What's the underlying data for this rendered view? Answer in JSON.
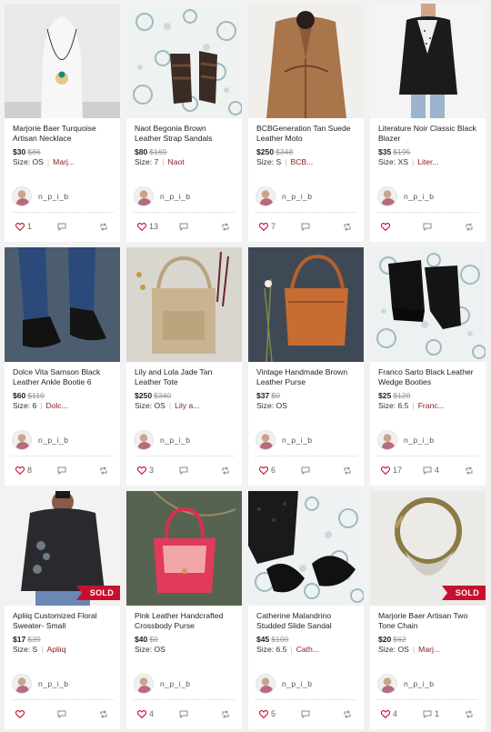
{
  "listings": [
    {
      "title": "Marjorie Baer Turquoise Artisan Necklace",
      "price": "$30",
      "original_price": "$86",
      "size_label": "Size: OS",
      "brand": "Marj...",
      "seller": "n_p_i_b",
      "likes": "1",
      "comments": "",
      "shares": "",
      "sold": false,
      "sold_label": "",
      "image": "necklace"
    },
    {
      "title": "Naot Begonia Brown Leather Strap Sandals",
      "price": "$80",
      "original_price": "$169",
      "size_label": "Size: 7",
      "brand": "Naot",
      "seller": "n_p_i_b",
      "likes": "13",
      "comments": "",
      "shares": "",
      "sold": false,
      "sold_label": "",
      "image": "sandals"
    },
    {
      "title": "BCBGeneration Tan Suede Leather Moto",
      "price": "$250",
      "original_price": "$348",
      "size_label": "Size: S",
      "brand": "BCB...",
      "seller": "n_p_i_b",
      "likes": "7",
      "comments": "",
      "shares": "",
      "sold": false,
      "sold_label": "",
      "image": "jacket"
    },
    {
      "title": "Literature Noir Classic Black Blazer",
      "price": "$35",
      "original_price": "$195",
      "size_label": "Size: XS",
      "brand": "Liter...",
      "seller": "n_p_i_b",
      "likes": "",
      "comments": "",
      "shares": "",
      "sold": false,
      "sold_label": "",
      "image": "blazer"
    },
    {
      "title": "Dolce Vita Samson Black Leather Ankle Bootie 6",
      "price": "$60",
      "original_price": "$110",
      "size_label": "Size: 6",
      "brand": "Dolc...",
      "seller": "n_p_i_b",
      "likes": "8",
      "comments": "",
      "shares": "",
      "sold": false,
      "sold_label": "",
      "image": "booties"
    },
    {
      "title": "Lily and Lola Jade Tan Leather Tote",
      "price": "$250",
      "original_price": "$340",
      "size_label": "Size: OS",
      "brand": "Lily a...",
      "seller": "n_p_i_b",
      "likes": "3",
      "comments": "",
      "shares": "",
      "sold": false,
      "sold_label": "",
      "image": "tote"
    },
    {
      "title": "Vintage Handmade Brown Leather Purse",
      "price": "$37",
      "original_price": "$0",
      "size_label": "Size: OS",
      "brand": "",
      "seller": "n_p_i_b",
      "likes": "6",
      "comments": "",
      "shares": "",
      "sold": false,
      "sold_label": "",
      "image": "purse"
    },
    {
      "title": "Franco Sarto Black Leather Wedge Booties",
      "price": "$25",
      "original_price": "$120",
      "size_label": "Size: 6.5",
      "brand": "Franc...",
      "seller": "n_p_i_b",
      "likes": "17",
      "comments": "4",
      "shares": "",
      "sold": false,
      "sold_label": "",
      "image": "wedge"
    },
    {
      "title": "Apliiq Customized Floral Sweater- Small",
      "price": "$17",
      "original_price": "$39",
      "size_label": "Size: S",
      "brand": "Apliiq",
      "seller": "n_p_i_b",
      "likes": "",
      "comments": "",
      "shares": "",
      "sold": true,
      "sold_label": "SOLD",
      "image": "sweater"
    },
    {
      "title": "Pink Leather Handcrafted Crossbody Purse",
      "price": "$40",
      "original_price": "$0",
      "size_label": "Size: OS",
      "brand": "",
      "seller": "n_p_i_b",
      "likes": "4",
      "comments": "",
      "shares": "",
      "sold": false,
      "sold_label": "",
      "image": "crossbody"
    },
    {
      "title": "Catherine Malandrino Studded Slide Sandal",
      "price": "$45",
      "original_price": "$100",
      "size_label": "Size: 6.5",
      "brand": "Cath...",
      "seller": "n_p_i_b",
      "likes": "5",
      "comments": "",
      "shares": "",
      "sold": false,
      "sold_label": "",
      "image": "slide"
    },
    {
      "title": "Marjorie Baer Artisan Two Tone Chain",
      "price": "$20",
      "original_price": "$62",
      "size_label": "Size: OS",
      "brand": "Marj...",
      "seller": "n_p_i_b",
      "likes": "4",
      "comments": "1",
      "shares": "",
      "sold": true,
      "sold_label": "SOLD",
      "image": "chain"
    }
  ],
  "colors": {
    "like": "#c8102e",
    "brand": "#8c1d24",
    "sold_badge": "#c8102e"
  }
}
